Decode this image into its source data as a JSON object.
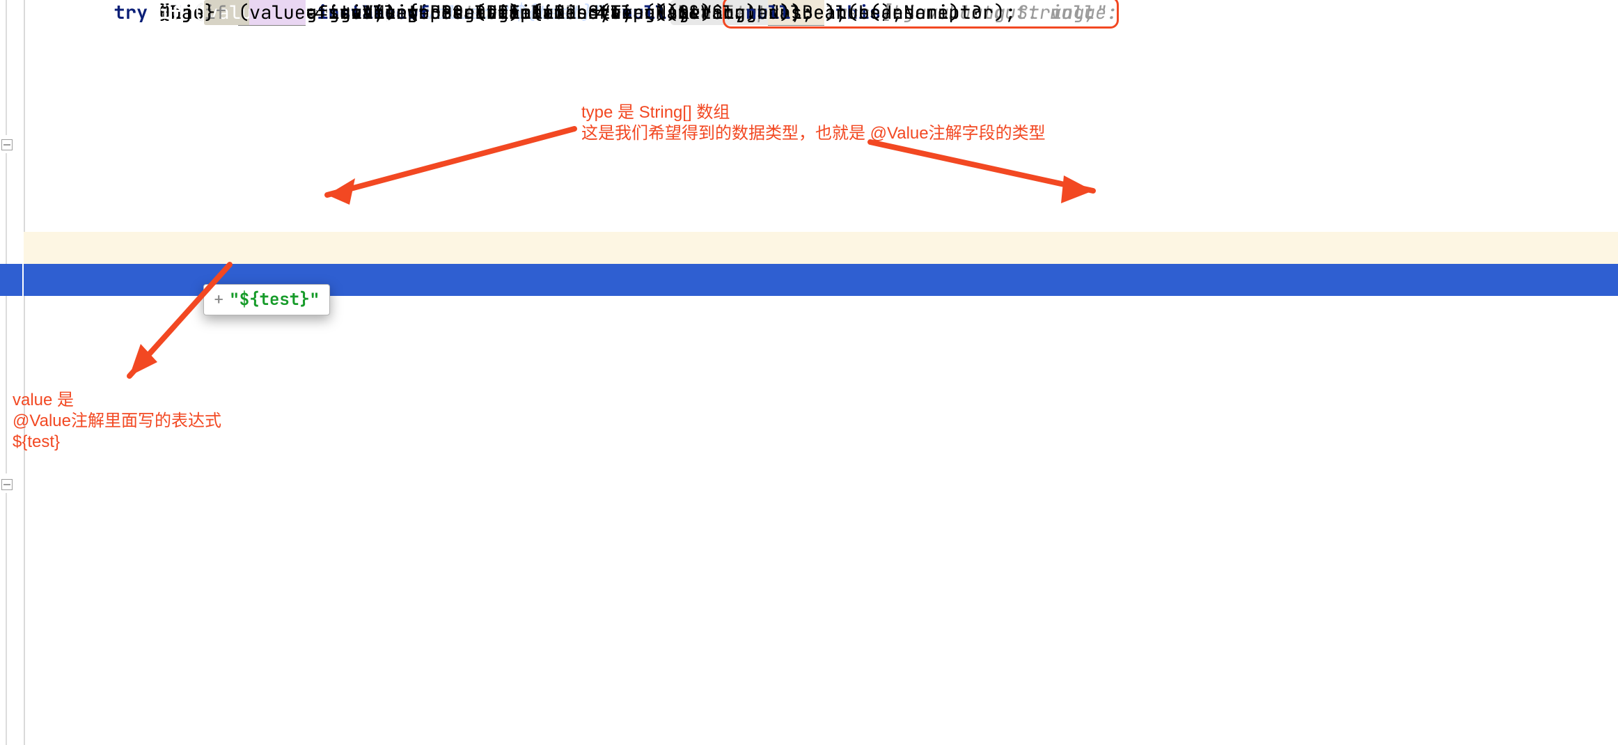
{
  "code": {
    "try": "try",
    "if": "if",
    "null": "null",
    "return": "return",
    "this": "this",
    "instanceof": "instanceof"
  },
  "hints": {
    "beanFactory": "beanFactory:"
  },
  "inlays": {
    "shortcut": "shortcut: null",
    "type": "type: \"class [Ljava.lang.String;\"",
    "value": "value: \"${test}\"",
    "value_cut": "value:"
  },
  "popup": {
    "value": "\"${test}\""
  },
  "annotations": {
    "type_line1": "type 是 String[] 数组",
    "type_line2": "这是我们希望得到的数据类型，也就是 @Value注解字段的类型",
    "value_line1": "value 是",
    "value_line2": "@Value注解里面写的表达式",
    "value_line3": "${test}"
  },
  "source_lines": [
    "try {",
    "    Object shortcut = descriptor.resolveShortcut( beanFactory: this);   // shortcut: null",
    "    if (shortcut != null) {",
    "        return shortcut;   // shortcut: null",
    "    }",
    "",
    "    Class<?> type = descriptor.getDependencyType();   // type: \"class [Ljava.lang.String;\"",
    "    Object value = getAutowireCandidateResolver().getSuggestedValue(descriptor);   // value:",
    "    if (value != null) {   // value: \"${test}\"",
    "        if (value instanceof String) {",
    "            String strVal = resolveEmbeddedValue((String) value);",
    "            BeanDefinition bd = (beanName != null && containsBean(beanName) ?",
    "                    getMergedBeanDefinition(beanName) : null);",
    "            value = evaluateBeanDefinitionString(strVal, bd);",
    "        }"
  ]
}
